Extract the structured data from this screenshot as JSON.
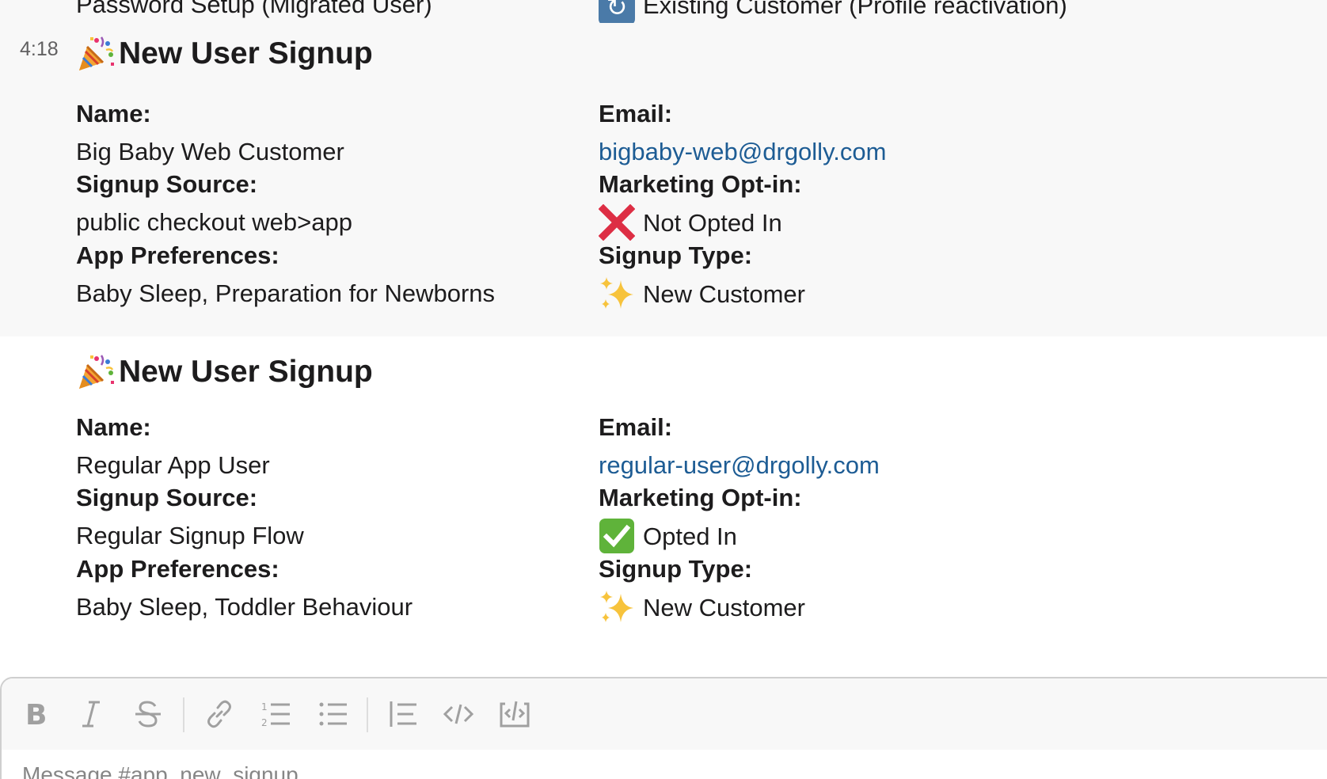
{
  "previous_message": {
    "left_text": "Password Setup (Migrated User)",
    "right_text": "Existing Customer (Profile reactivation)",
    "right_icon": "refresh-icon"
  },
  "messages": [
    {
      "timestamp": "4:18",
      "title_icon": "party-popper-icon",
      "title": "New User Signup",
      "fields": {
        "name_label": "Name:",
        "name_value": "Big Baby Web Customer",
        "email_label": "Email:",
        "email_value": "bigbaby-web@drgolly.com",
        "source_label": "Signup Source:",
        "source_value": "public checkout web>app",
        "optin_label": "Marketing Opt-in:",
        "optin_icon": "cross-mark-icon",
        "optin_value": "Not Opted In",
        "prefs_label": "App Preferences:",
        "prefs_value": "Baby Sleep, Preparation for Newborns",
        "type_label": "Signup Type:",
        "type_icon": "sparkles-icon",
        "type_value": "New Customer"
      }
    },
    {
      "timestamp": "",
      "title_icon": "party-popper-icon",
      "title": "New User Signup",
      "fields": {
        "name_label": "Name:",
        "name_value": "Regular App User",
        "email_label": "Email:",
        "email_value": "regular-user@drgolly.com",
        "source_label": "Signup Source:",
        "source_value": "Regular Signup Flow",
        "optin_label": "Marketing Opt-in:",
        "optin_icon": "check-mark-icon",
        "optin_value": "Opted In",
        "prefs_label": "App Preferences:",
        "prefs_value": "Baby Sleep, Toddler Behaviour",
        "type_label": "Signup Type:",
        "type_icon": "sparkles-icon",
        "type_value": "New Customer"
      }
    }
  ],
  "composer": {
    "placeholder": "Message #app_new_signup",
    "toolbar": [
      "bold-icon",
      "italic-icon",
      "strikethrough-icon",
      "link-icon",
      "ordered-list-icon",
      "bulleted-list-icon",
      "blockquote-icon",
      "code-icon",
      "code-block-icon"
    ]
  },
  "colors": {
    "hover_bg": "#f8f8f8",
    "link": "#1d5c94",
    "text": "#1d1c1d",
    "muted": "#616061",
    "cross_red": "#dd2e44",
    "check_green": "#5fb33a",
    "sparkle_yellow": "#f7c33c"
  }
}
